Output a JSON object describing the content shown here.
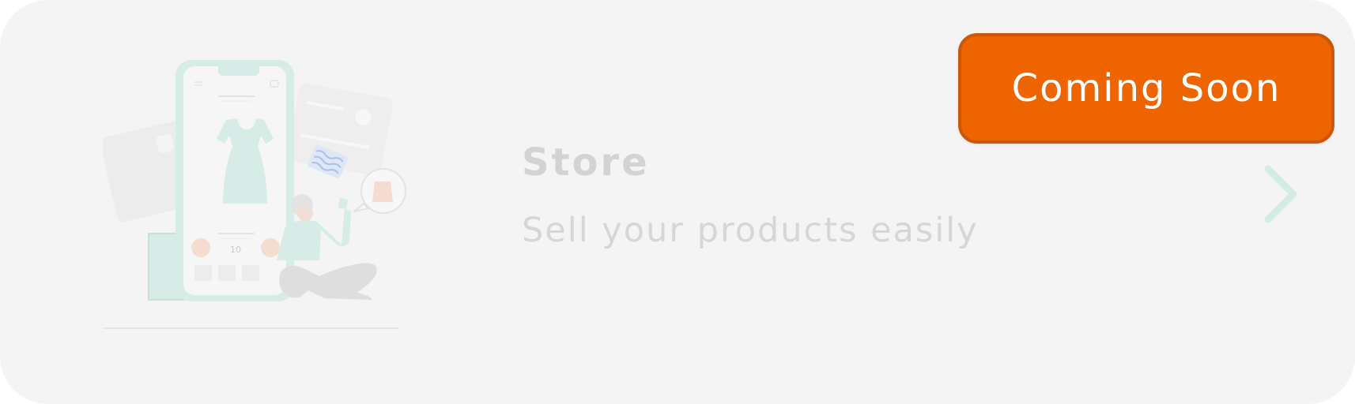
{
  "card": {
    "title": "Store",
    "subtitle": "Sell your products easily",
    "badge_label": "Coming Soon"
  },
  "illustration": {
    "price": "10",
    "name": "online-shopping-illustration"
  },
  "colors": {
    "card_background": "#f4f4f4",
    "badge_background": "#ee6500",
    "badge_border": "#c9580c",
    "title_text": "#d3d3d3",
    "chevron": "#d4ece6",
    "illustration_accent": "#d7ece7",
    "illustration_peach": "#f4ddd0"
  },
  "icons": {
    "chevron": "chevron-right-icon",
    "menu": "hamburger-menu-icon",
    "cart": "shopping-cart-icon"
  }
}
